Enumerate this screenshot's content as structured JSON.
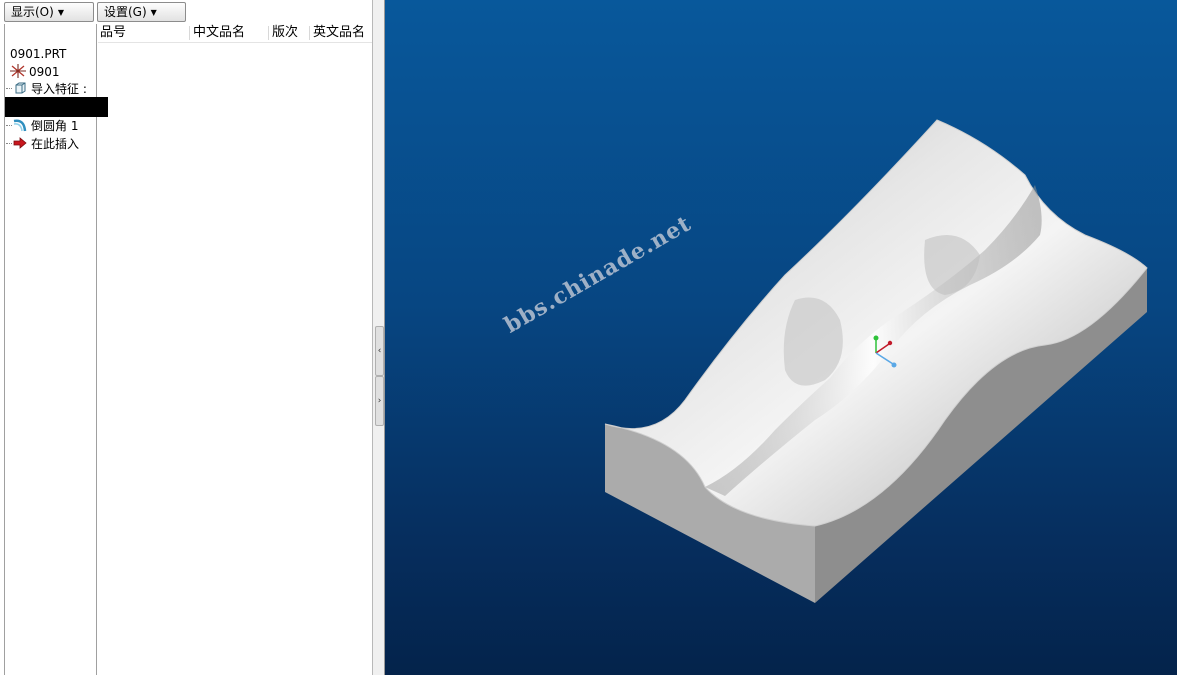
{
  "menu": {
    "display_label": "显示(O)",
    "settings_label": "设置(G)"
  },
  "columns": [
    "品号",
    "中文品名",
    "版次",
    "英文品名"
  ],
  "tree": {
    "root": "0901.PRT",
    "items": [
      {
        "icon": "csys-icon",
        "label": "0901"
      },
      {
        "icon": "import-feature-icon",
        "label": "导入特征 :"
      },
      {
        "icon": "round-icon",
        "label": "倒圆角 1"
      },
      {
        "icon": "insert-here-arrow-icon",
        "label": "在此插入"
      }
    ]
  },
  "splitter": {
    "collapse_glyph": "‹",
    "expand_glyph": "›"
  },
  "viewport": {
    "watermark": "bbs.chinade.net",
    "background_colors": [
      "#08589b",
      "#04234b"
    ],
    "model_color": "#d8d8d8"
  }
}
